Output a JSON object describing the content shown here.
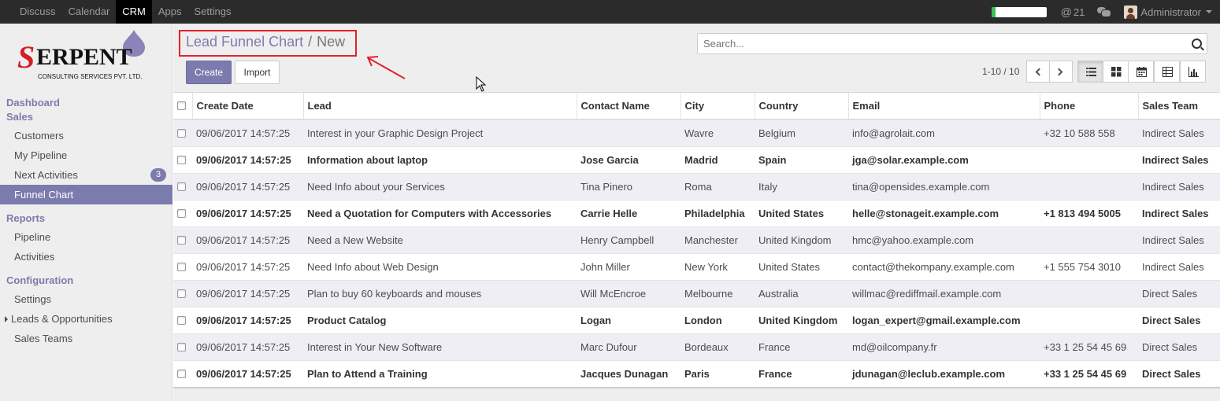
{
  "topbar": {
    "menu": [
      "Discuss",
      "Calendar",
      "CRM",
      "Apps",
      "Settings"
    ],
    "active_menu": "CRM",
    "progress_fraction": 0.08,
    "message_count": "21",
    "user_name": "Administrator"
  },
  "sidebar": {
    "dashboard": "Dashboard",
    "sales_head": "Sales",
    "sales_items": [
      "Customers",
      "My Pipeline",
      "Next Activities",
      "Funnel Chart"
    ],
    "next_activities_badge": "3",
    "reports_head": "Reports",
    "reports_items": [
      "Pipeline",
      "Activities"
    ],
    "config_head": "Configuration",
    "config_items": [
      "Settings",
      "Leads & Opportunities",
      "Sales Teams"
    ]
  },
  "control_panel": {
    "breadcrumb_parent": "Lead Funnel Chart",
    "breadcrumb_sep": "/",
    "breadcrumb_current": "New",
    "create_label": "Create",
    "import_label": "Import",
    "search_placeholder": "Search...",
    "pager_text": "1-10 / 10"
  },
  "table": {
    "columns": [
      "Create Date",
      "Lead",
      "Contact Name",
      "City",
      "Country",
      "Email",
      "Phone",
      "Sales Team"
    ],
    "rows": [
      {
        "date": "09/06/2017 14:57:25",
        "lead": "Interest in your Graphic Design Project",
        "contact": "",
        "city": "Wavre",
        "country": "Belgium",
        "email": "info@agrolait.com",
        "phone": "+32 10 588 558",
        "team": "Indirect Sales",
        "bold": false
      },
      {
        "date": "09/06/2017 14:57:25",
        "lead": "Information about laptop",
        "contact": "Jose Garcia",
        "city": "Madrid",
        "country": "Spain",
        "email": "jga@solar.example.com",
        "phone": "",
        "team": "Indirect Sales",
        "bold": true
      },
      {
        "date": "09/06/2017 14:57:25",
        "lead": "Need Info about your Services",
        "contact": "Tina Pinero",
        "city": "Roma",
        "country": "Italy",
        "email": "tina@opensides.example.com",
        "phone": "",
        "team": "Indirect Sales",
        "bold": false
      },
      {
        "date": "09/06/2017 14:57:25",
        "lead": "Need a Quotation for Computers with Accessories",
        "contact": "Carrie Helle",
        "city": "Philadelphia",
        "country": "United States",
        "email": "helle@stonageit.example.com",
        "phone": "+1 813 494 5005",
        "team": "Indirect Sales",
        "bold": true
      },
      {
        "date": "09/06/2017 14:57:25",
        "lead": "Need a New Website",
        "contact": "Henry Campbell",
        "city": "Manchester",
        "country": "United Kingdom",
        "email": "hmc@yahoo.example.com",
        "phone": "",
        "team": "Indirect Sales",
        "bold": false
      },
      {
        "date": "09/06/2017 14:57:25",
        "lead": "Need Info about Web Design",
        "contact": "John Miller",
        "city": "New York",
        "country": "United States",
        "email": "contact@thekompany.example.com",
        "phone": "+1 555 754 3010",
        "team": "Indirect Sales",
        "bold": false
      },
      {
        "date": "09/06/2017 14:57:25",
        "lead": "Plan to buy 60 keyboards and mouses",
        "contact": "Will McEncroe",
        "city": "Melbourne",
        "country": "Australia",
        "email": "willmac@rediffmail.example.com",
        "phone": "",
        "team": "Direct Sales",
        "bold": false
      },
      {
        "date": "09/06/2017 14:57:25",
        "lead": "Product Catalog",
        "contact": "Logan",
        "city": "London",
        "country": "United Kingdom",
        "email": "logan_expert@gmail.example.com",
        "phone": "",
        "team": "Direct Sales",
        "bold": true
      },
      {
        "date": "09/06/2017 14:57:25",
        "lead": "Interest in Your New Software",
        "contact": "Marc Dufour",
        "city": "Bordeaux",
        "country": "France",
        "email": "md@oilcompany.fr",
        "phone": "+33 1 25 54 45 69",
        "team": "Direct Sales",
        "bold": false
      },
      {
        "date": "09/06/2017 14:57:25",
        "lead": "Plan to Attend a Training",
        "contact": "Jacques Dunagan",
        "city": "Paris",
        "country": "France",
        "email": "jdunagan@leclub.example.com",
        "phone": "+33 1 25 54 45 69",
        "team": "Direct Sales",
        "bold": true
      }
    ]
  },
  "colors": {
    "accent": "#7c7bad",
    "topbar": "#2b2b2b",
    "annotation": "#e0232d"
  }
}
